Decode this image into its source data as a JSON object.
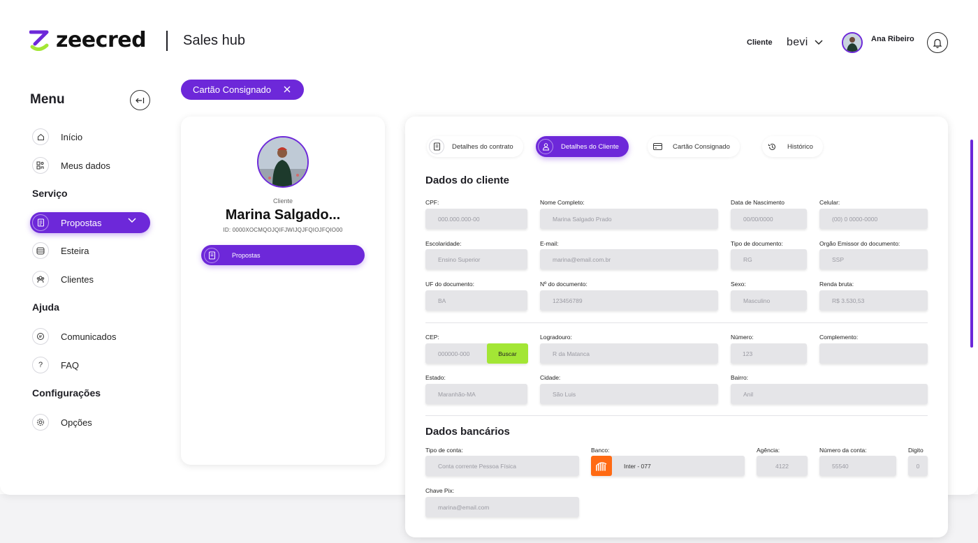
{
  "header": {
    "brand": "zeecred",
    "app_title": "Sales hub",
    "client_label": "Cliente",
    "client_value": "bevi",
    "user_name": "Ana Ribeiro"
  },
  "sidebar": {
    "title": "Menu",
    "sections": {
      "servico": "Serviço",
      "ajuda": "Ajuda",
      "config": "Configurações"
    },
    "items": {
      "inicio": "Início",
      "meus_dados": "Meus dados",
      "propostas": "Propostas",
      "esteira": "Esteira",
      "clientes": "Clientes",
      "comunicados": "Comunicados",
      "faq": "FAQ",
      "opcoes": "Opções"
    },
    "faq_icon": "?"
  },
  "chip": {
    "label": "Cartão Consignado"
  },
  "client_card": {
    "label": "Cliente",
    "name": "Marina Salgado...",
    "id": "ID: 0000XOCMQOJQIFJWIJQJFQIOJFQIO00",
    "button": "Propostas"
  },
  "tabs": {
    "contrato": "Detalhes do contrato",
    "cliente": "Detalhes do Cliente",
    "cartao": "Cartão Consignado",
    "historico": "Histórico"
  },
  "dados_cliente": {
    "title": "Dados do cliente",
    "cpf": {
      "label": "CPF:",
      "value": "000.000.000-00"
    },
    "nome": {
      "label": "Nome Completo:",
      "value": "Marina Salgado Prado"
    },
    "nascimento": {
      "label": "Data de Nascimento",
      "value": "00/00/0000"
    },
    "celular": {
      "label": "Celular:",
      "value": "(00) 0 0000-0000"
    },
    "escolaridade": {
      "label": "Escolaridade:",
      "value": "Ensino Superior"
    },
    "email": {
      "label": "E-mail:",
      "value": "marina@email.com.br"
    },
    "tipo_doc": {
      "label": "Tipo de documento:",
      "value": "RG"
    },
    "orgao": {
      "label": "Orgão Emissor do documento:",
      "value": "SSP"
    },
    "uf_doc": {
      "label": "UF do documento:",
      "value": "BA"
    },
    "num_doc": {
      "label": "Nº do documento:",
      "value": "123456789"
    },
    "sexo": {
      "label": "Sexo:",
      "value": "Masculino"
    },
    "renda": {
      "label": "Renda bruta:",
      "value": "R$ 3.530,53"
    },
    "cep": {
      "label": "CEP:",
      "value": "000000-000",
      "button": "Buscar"
    },
    "logradouro": {
      "label": "Logradouro:",
      "value": "R da Matanca"
    },
    "numero": {
      "label": "Número:",
      "value": "123"
    },
    "complemento": {
      "label": "Complemento:",
      "value": ""
    },
    "estado": {
      "label": "Estado:",
      "value": "Maranhão-MA"
    },
    "cidade": {
      "label": "Cidade:",
      "value": "São Luis"
    },
    "bairro": {
      "label": "Bairro:",
      "value": "Anil"
    }
  },
  "dados_bancarios": {
    "title": "Dados bancários",
    "tipo_conta": {
      "label": "Tipo de conta:",
      "value": "Conta corrente Pessoa Física"
    },
    "banco": {
      "label": "Banco:",
      "value": "Inter - 077"
    },
    "agencia": {
      "label": "Agência:",
      "value": "4122"
    },
    "numero_conta": {
      "label": "Número da conta:",
      "value": "55540"
    },
    "digito": {
      "label": "Digito",
      "value": "0"
    },
    "chave_pix": {
      "label": "Chave Pix:",
      "value": "marina@email.com"
    }
  },
  "colors": {
    "accent": "#6d28d9",
    "lime": "#a3e635",
    "bank_orange": "#ff6a13"
  }
}
